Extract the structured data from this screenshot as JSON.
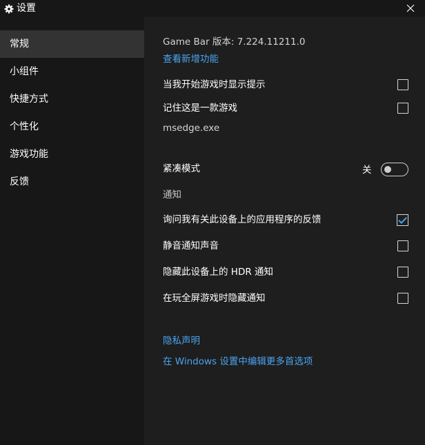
{
  "window": {
    "title": "设置"
  },
  "sidebar": {
    "items": [
      {
        "label": "常规",
        "active": true
      },
      {
        "label": "小组件",
        "active": false
      },
      {
        "label": "快捷方式",
        "active": false
      },
      {
        "label": "个性化",
        "active": false
      },
      {
        "label": "游戏功能",
        "active": false
      },
      {
        "label": "反馈",
        "active": false
      }
    ]
  },
  "general": {
    "version": "Game Bar 版本: 7.224.11211.0",
    "whats_new_link": "查看新增功能",
    "show_tips": {
      "label": "当我开始游戏时显示提示",
      "checked": false
    },
    "remember_game": {
      "label": "记住这是一款游戏",
      "checked": false
    },
    "process_name": "msedge.exe",
    "compact_mode": {
      "label": "紧凑模式",
      "state": "关",
      "on": false
    },
    "notifications_header": "通知",
    "notify_ask_feedback": {
      "label": "询问我有关此设备上的应用程序的反馈",
      "checked": true
    },
    "notify_mute_sound": {
      "label": "静音通知声音",
      "checked": false
    },
    "notify_hide_hdr": {
      "label": "隐藏此设备上的 HDR 通知",
      "checked": false
    },
    "notify_hide_fullscreen": {
      "label": "在玩全屏游戏时隐藏通知",
      "checked": false
    },
    "privacy_link": "隐私声明",
    "windows_settings_link": "在 Windows 设置中编辑更多首选项"
  },
  "colors": {
    "accent": "#4aa3f0",
    "sidebar_bg": "#171717",
    "content_bg": "#1e1e1e",
    "active_item_bg": "#333333"
  },
  "icons": {
    "title": "gear-icon",
    "close": "close-icon",
    "check": "checkmark-icon"
  }
}
